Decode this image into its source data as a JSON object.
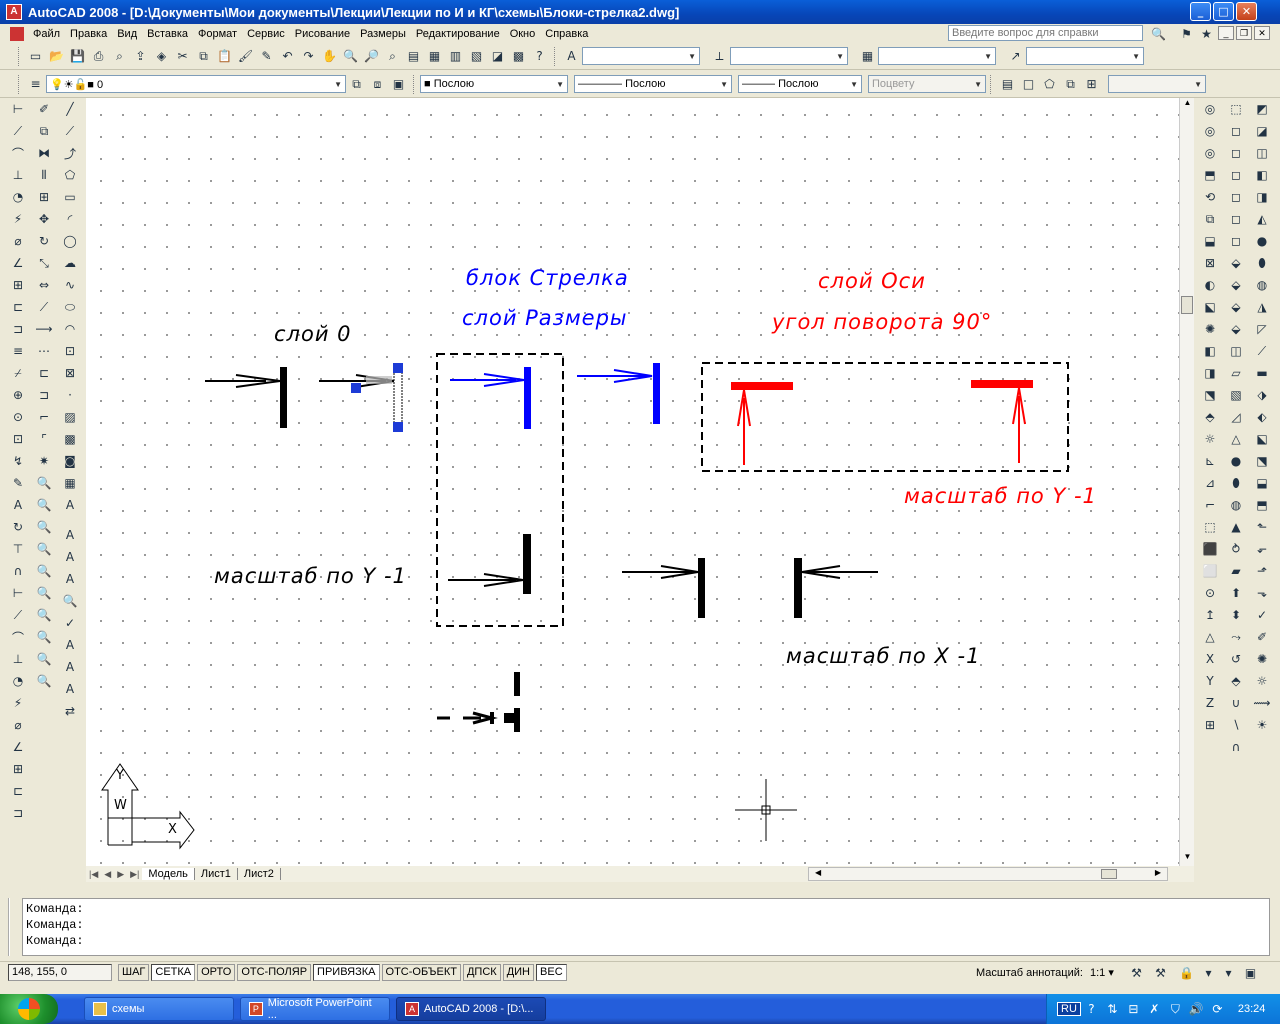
{
  "window": {
    "title": "AutoCAD 2008 - [D:\\Документы\\Мои документы\\Лекции\\Лекции по И и КГ\\схемы\\Блоки-стрелка2.dwg]"
  },
  "menu": [
    "Файл",
    "Правка",
    "Вид",
    "Вставка",
    "Формат",
    "Сервис",
    "Рисование",
    "Размеры",
    "Редактирование",
    "Окно",
    "Справка"
  ],
  "help": {
    "placeholder": "Введите вопрос для справки"
  },
  "layer_combo": {
    "value": "0"
  },
  "properties": {
    "color": "Послою",
    "linetype": "Послою",
    "lineweight": "Послою",
    "plotstyle": "Поцвету"
  },
  "drawing": {
    "annotations": [
      {
        "text": "слой 0",
        "color": "#000000"
      },
      {
        "text": "блок Стрелка",
        "color": "#0000ff"
      },
      {
        "text": "слой Размеры",
        "color": "#0000ff"
      },
      {
        "text": "слой Оси",
        "color": "#ff0000"
      },
      {
        "text": "угол поворота 90°",
        "color": "#ff0000"
      },
      {
        "text": "масштаб по Y -1",
        "color": "#ff0000"
      },
      {
        "text": "масштаб по Y -1",
        "color": "#000000"
      },
      {
        "text": "масштаб по X -1",
        "color": "#000000"
      }
    ],
    "ucs": {
      "y": "Y",
      "w": "W",
      "x": "X"
    }
  },
  "tabs": [
    "Модель",
    "Лист1",
    "Лист2"
  ],
  "command": {
    "lines": [
      "Команда:",
      "Команда:",
      "Команда:"
    ]
  },
  "status": {
    "coords": "148, 155, 0",
    "toggles": [
      "ШАГ",
      "СЕТКА",
      "ОРТО",
      "ОТС-ПОЛЯР",
      "ПРИВЯЗКА",
      "ОТС-ОБЪЕКТ",
      "ДПСК",
      "ДИН",
      "ВЕС"
    ],
    "annotation_scale_label": "Масштаб аннотаций:",
    "annotation_scale": "1:1"
  },
  "taskbar": {
    "tasks": [
      "схемы",
      "Microsoft PowerPoint ...",
      "AutoCAD 2008 - [D:\\..."
    ],
    "lang": "RU",
    "clock": "23:24"
  }
}
